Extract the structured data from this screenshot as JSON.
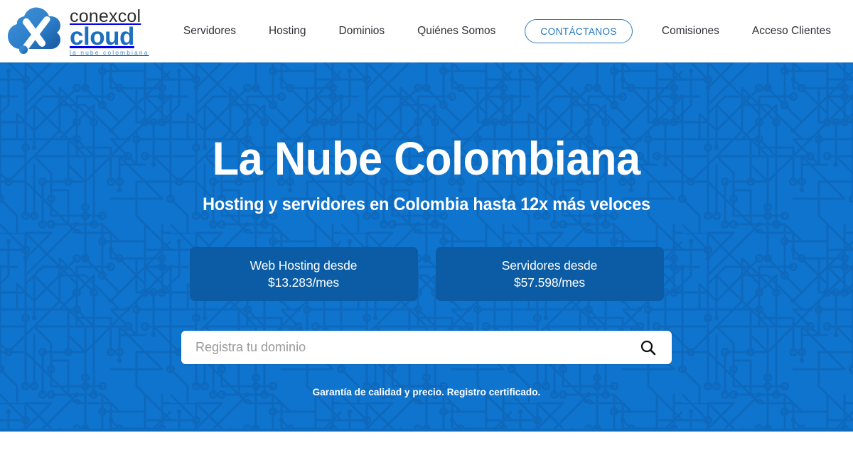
{
  "brand": {
    "logo_icon": "cloud-x-logo-icon",
    "name_top": "conexcol",
    "name_bottom": "cloud",
    "tagline": "la nube colombiana",
    "logo_blue": "#1b6fc0",
    "logo_dark": "#2b2b2b"
  },
  "nav": {
    "items": [
      {
        "label": "Servidores",
        "name": "nav-item-servidores"
      },
      {
        "label": "Hosting",
        "name": "nav-item-hosting"
      },
      {
        "label": "Dominios",
        "name": "nav-item-dominios"
      },
      {
        "label": "Quiénes Somos",
        "name": "nav-item-quienes-somos"
      }
    ],
    "cta_label": "CONTÁCTANOS",
    "items_right": [
      {
        "label": "Comisiones",
        "name": "nav-item-comisiones"
      },
      {
        "label": "Acceso Clientes",
        "name": "nav-item-acceso-clientes"
      }
    ]
  },
  "hero": {
    "title": "La Nube Colombiana",
    "subtitle": "Hosting y servidores en Colombia hasta 12x más veloces",
    "background_color": "#0f74ce",
    "pattern": "circuit-board-pattern",
    "cards": [
      {
        "line1": "Web Hosting desde",
        "line2": "$13.283/mes",
        "name": "cta-web-hosting"
      },
      {
        "line1": "Servidores desde",
        "line2": "$57.598/mes",
        "name": "cta-servidores"
      }
    ],
    "card_color": "#0b5ca5",
    "search": {
      "placeholder": "Registra tu dominio",
      "value": "",
      "button_icon": "search-icon"
    },
    "guarantee": "Garantía de calidad y precio. Registro certificado."
  }
}
